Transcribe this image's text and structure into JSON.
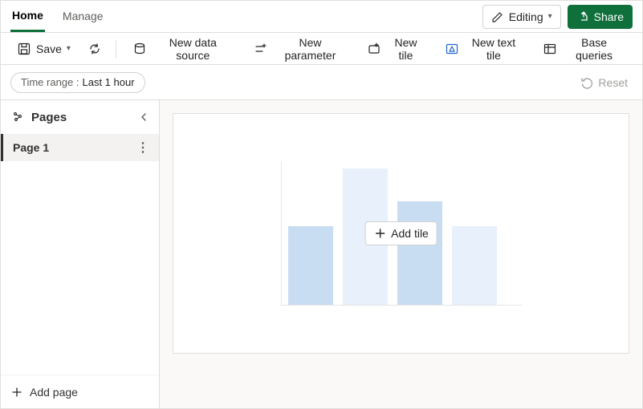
{
  "tabs": {
    "home": "Home",
    "manage": "Manage"
  },
  "header": {
    "editing": "Editing",
    "share": "Share"
  },
  "toolbar": {
    "save": "Save",
    "new_data_source": "New data source",
    "new_parameter": "New parameter",
    "new_tile": "New tile",
    "new_text_tile": "New text tile",
    "base_queries": "Base queries"
  },
  "filter": {
    "time_label": "Time range :",
    "time_value": "Last 1 hour",
    "reset": "Reset"
  },
  "sidebar": {
    "title": "Pages",
    "page1": "Page 1",
    "add_page": "Add page"
  },
  "canvas": {
    "add_tile": "Add tile"
  }
}
